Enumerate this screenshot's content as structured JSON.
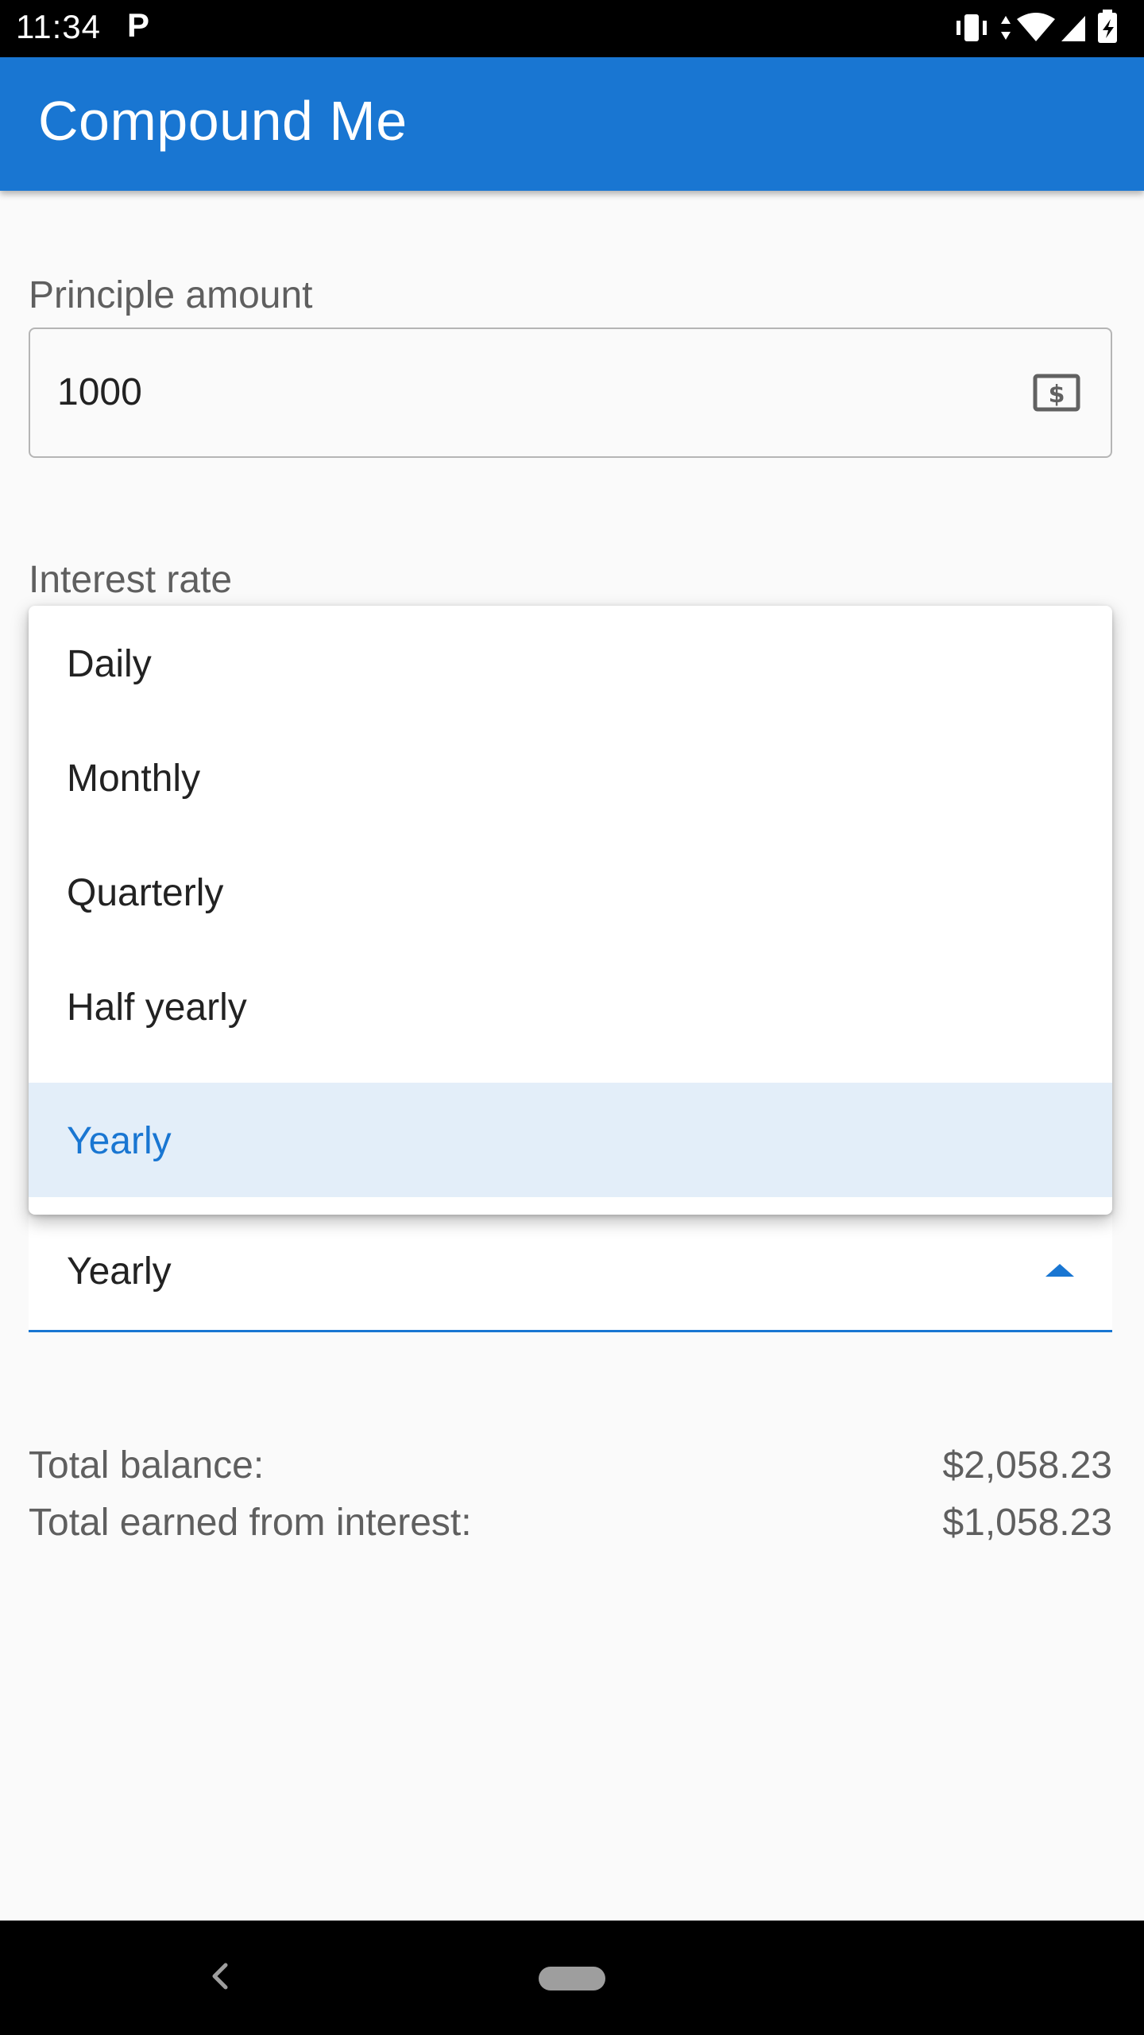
{
  "status_bar": {
    "time": "11:34",
    "notification": "P"
  },
  "app_bar": {
    "title": "Compound Me"
  },
  "principle": {
    "label": "Principle amount",
    "value": "1000",
    "icon": "money-icon"
  },
  "interest": {
    "label": "Interest rate"
  },
  "compounding": {
    "selected": "Yearly",
    "options": [
      "Daily",
      "Monthly",
      "Quarterly",
      "Half yearly",
      "Yearly"
    ]
  },
  "summary": {
    "total_balance_label": "Total balance:",
    "total_balance_value": "$2,058.23",
    "interest_label": "Total earned from interest:",
    "interest_value": "$1,058.23"
  },
  "colors": {
    "accent": "#1976d2",
    "selected_bg": "#e3eef9"
  }
}
